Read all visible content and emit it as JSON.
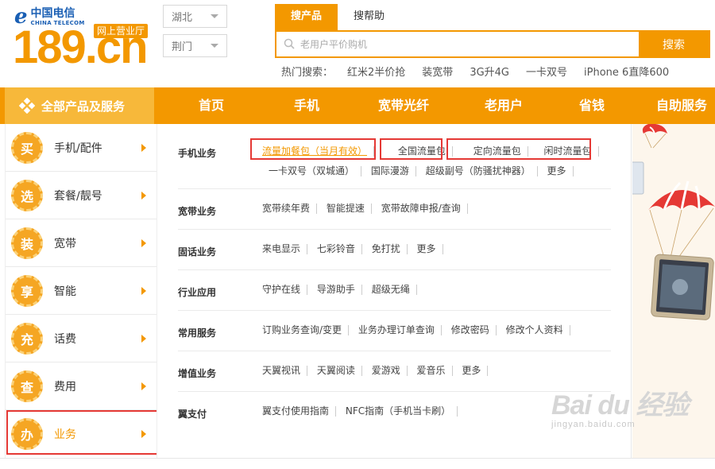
{
  "logo": {
    "brand_cn": "中国电信",
    "brand_en": "CHINA TELECOM",
    "site": "189.cn",
    "badge": "网上营业厅"
  },
  "region": {
    "province": "湖北",
    "city": "荆门"
  },
  "search": {
    "tabs": [
      "搜产品",
      "搜帮助"
    ],
    "placeholder": "老用户平价购机",
    "button": "搜索",
    "hot_label": "热门搜索：",
    "hot_keywords": [
      "红米2半价抢",
      "装宽带",
      "3G升4G",
      "一卡双号",
      "iPhone 6直降600"
    ]
  },
  "nav": {
    "all_categories": "全部产品及服务",
    "items": [
      "首页",
      "手机",
      "宽带光纤",
      "老用户",
      "省钱",
      "自助服务"
    ]
  },
  "categories": [
    {
      "icon_text": "买",
      "label": "手机/配件"
    },
    {
      "icon_text": "选",
      "label": "套餐/靓号"
    },
    {
      "icon_text": "装",
      "label": "宽带"
    },
    {
      "icon_text": "享",
      "label": "智能"
    },
    {
      "icon_text": "充",
      "label": "话费"
    },
    {
      "icon_text": "查",
      "label": "费用"
    },
    {
      "icon_text": "办",
      "label": "业务"
    }
  ],
  "submenu": [
    {
      "title": "手机业务",
      "links": [
        "流量加餐包（当月有效）",
        "全国流量包",
        "定向流量包",
        "闲时流量包",
        "一卡双号（双城通）",
        "国际漫游",
        "超级副号（防骚扰神器）",
        "更多"
      ]
    },
    {
      "title": "宽带业务",
      "links": [
        "宽带续年费",
        "智能提速",
        "宽带故障申报/查询"
      ]
    },
    {
      "title": "固话业务",
      "links": [
        "来电显示",
        "七彩铃音",
        "免打扰",
        "更多"
      ]
    },
    {
      "title": "行业应用",
      "links": [
        "守护在线",
        "导游助手",
        "超级无绳"
      ]
    },
    {
      "title": "常用服务",
      "links": [
        "订购业务查询/变更",
        "业务办理订单查询",
        "修改密码",
        "修改个人资料"
      ]
    },
    {
      "title": "增值业务",
      "links": [
        "天翼视讯",
        "天翼阅读",
        "爱游戏",
        "爱音乐",
        "更多"
      ]
    },
    {
      "title": "翼支付",
      "links": [
        "翼支付使用指南",
        "NFC指南（手机当卡刷）"
      ]
    }
  ],
  "watermark": {
    "brand": "Bai du 经验",
    "url": "jingyan.baidu.com"
  },
  "colors": {
    "accent": "#f39800",
    "highlight_box": "#e53935"
  }
}
